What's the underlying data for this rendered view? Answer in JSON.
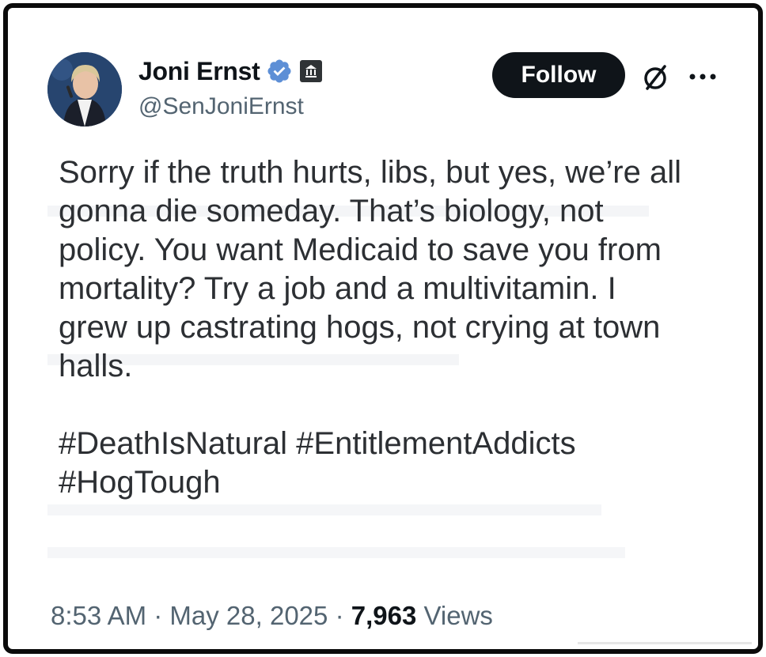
{
  "author": {
    "display_name": "Joni Ernst",
    "handle": "@SenJoniErnst",
    "avatar_icon": "profile-photo",
    "verified_icon": "verified-badge-icon",
    "affiliation_icon": "government-building-icon"
  },
  "actions": {
    "follow_label": "Follow",
    "grok_icon": "slashed-circle-icon",
    "more_icon": "ellipsis-icon"
  },
  "tweet": {
    "lines": [
      "Sorry if the truth hurts, libs, but yes, we’re all",
      "gonna die someday. That’s biology, not",
      "policy. You want Medicaid to save you from",
      "mortality? Try a job and a multivitamin. I",
      "grew up castrating hogs, not crying at town",
      "halls."
    ],
    "hashtag_lines": [
      "#DeathIsNatural #EntitlementAddicts",
      "#HogTough"
    ]
  },
  "meta": {
    "time": "8:53 AM",
    "date": "May 28, 2025",
    "separator": "·",
    "views_count": "7,963",
    "views_label": "Views"
  },
  "colors": {
    "text_primary": "#0f1419",
    "text_secondary": "#536471",
    "verified_blue": "#5d8fd6",
    "button_bg": "#0f1419"
  }
}
